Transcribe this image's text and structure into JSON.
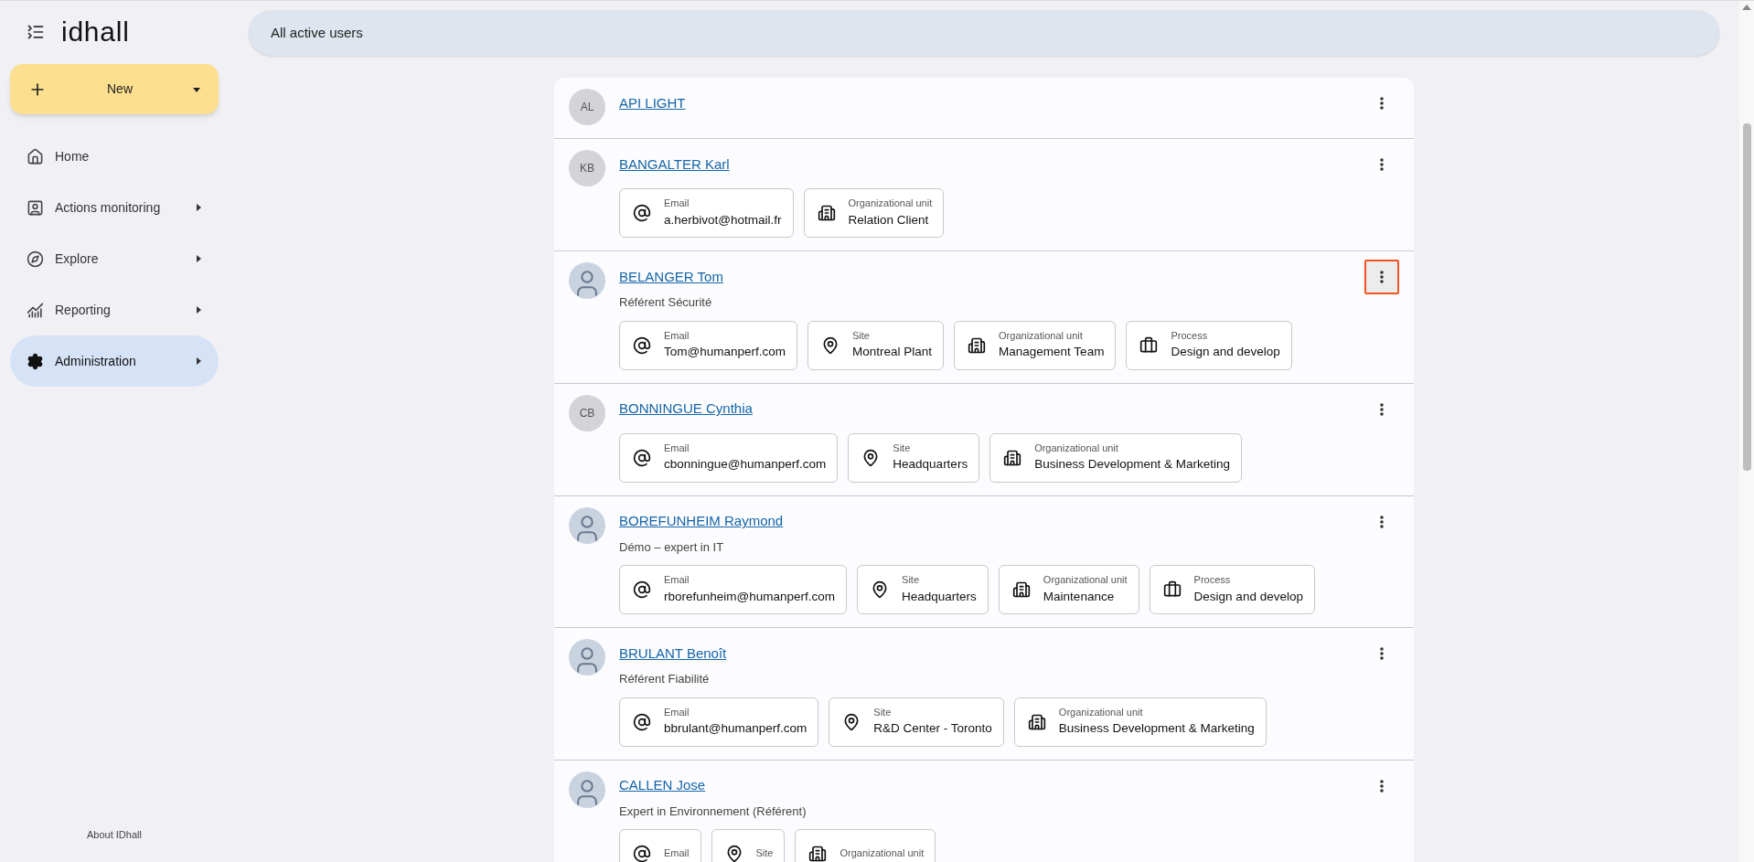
{
  "sidebar": {
    "logo": "idhall",
    "new_button": {
      "label": "New"
    },
    "items": [
      {
        "label": "Home",
        "has_submenu": false,
        "selected": false
      },
      {
        "label": "Actions monitoring",
        "has_submenu": true,
        "selected": false
      },
      {
        "label": "Explore",
        "has_submenu": true,
        "selected": false
      },
      {
        "label": "Reporting",
        "has_submenu": true,
        "selected": false
      },
      {
        "label": "Administration",
        "has_submenu": true,
        "selected": true
      }
    ],
    "footer_link": "About IDhall"
  },
  "header": {
    "title": "All active users"
  },
  "users": [
    {
      "avatar": {
        "kind": "initials",
        "text": "AL"
      },
      "name": "API LIGHT",
      "menu_highlighted": false
    },
    {
      "avatar": {
        "kind": "initials",
        "text": "KB"
      },
      "name": "BANGALTER Karl",
      "menu_highlighted": false,
      "fields": [
        {
          "kind": "email",
          "label": "Email",
          "value": "a.herbivot@hotmail.fr"
        },
        {
          "kind": "unit",
          "label": "Organizational unit",
          "value": "Relation Client"
        }
      ]
    },
    {
      "avatar": {
        "kind": "photo"
      },
      "name": "BELANGER Tom",
      "role": "Référent Sécurité",
      "menu_highlighted": true,
      "fields": [
        {
          "kind": "email",
          "label": "Email",
          "value": "Tom@humanperf.com"
        },
        {
          "kind": "site",
          "label": "Site",
          "value": "Montreal Plant"
        },
        {
          "kind": "unit",
          "label": "Organizational unit",
          "value": "Management Team"
        },
        {
          "kind": "process",
          "label": "Process",
          "value": "Design and develop"
        }
      ]
    },
    {
      "avatar": {
        "kind": "initials",
        "text": "CB"
      },
      "name": "BONNINGUE Cynthia",
      "menu_highlighted": false,
      "fields": [
        {
          "kind": "email",
          "label": "Email",
          "value": "cbonningue@humanperf.com"
        },
        {
          "kind": "site",
          "label": "Site",
          "value": "Headquarters"
        },
        {
          "kind": "unit",
          "label": "Organizational unit",
          "value": "Business Development & Marketing"
        }
      ]
    },
    {
      "avatar": {
        "kind": "photo"
      },
      "name": "BOREFUNHEIM Raymond",
      "role": "Démo – expert in IT",
      "menu_highlighted": false,
      "fields": [
        {
          "kind": "email",
          "label": "Email",
          "value": "rborefunheim@humanperf.com"
        },
        {
          "kind": "site",
          "label": "Site",
          "value": "Headquarters"
        },
        {
          "kind": "unit",
          "label": "Organizational unit",
          "value": "Maintenance"
        },
        {
          "kind": "process",
          "label": "Process",
          "value": "Design and develop"
        }
      ]
    },
    {
      "avatar": {
        "kind": "photo"
      },
      "name": "BRULANT Benoît",
      "role": "Référent Fiabilité",
      "menu_highlighted": false,
      "fields": [
        {
          "kind": "email",
          "label": "Email",
          "value": "bbrulant@humanperf.com"
        },
        {
          "kind": "site",
          "label": "Site",
          "value": "R&D Center - Toronto"
        },
        {
          "kind": "unit",
          "label": "Organizational unit",
          "value": "Business Development & Marketing"
        }
      ]
    },
    {
      "avatar": {
        "kind": "photo"
      },
      "name": "CALLEN Jose",
      "role": "Expert in Environnement (Référent)",
      "menu_highlighted": false,
      "fields": [
        {
          "kind": "email",
          "label": "Email"
        },
        {
          "kind": "site",
          "label": "Site"
        },
        {
          "kind": "unit",
          "label": "Organizational unit"
        }
      ]
    }
  ]
}
